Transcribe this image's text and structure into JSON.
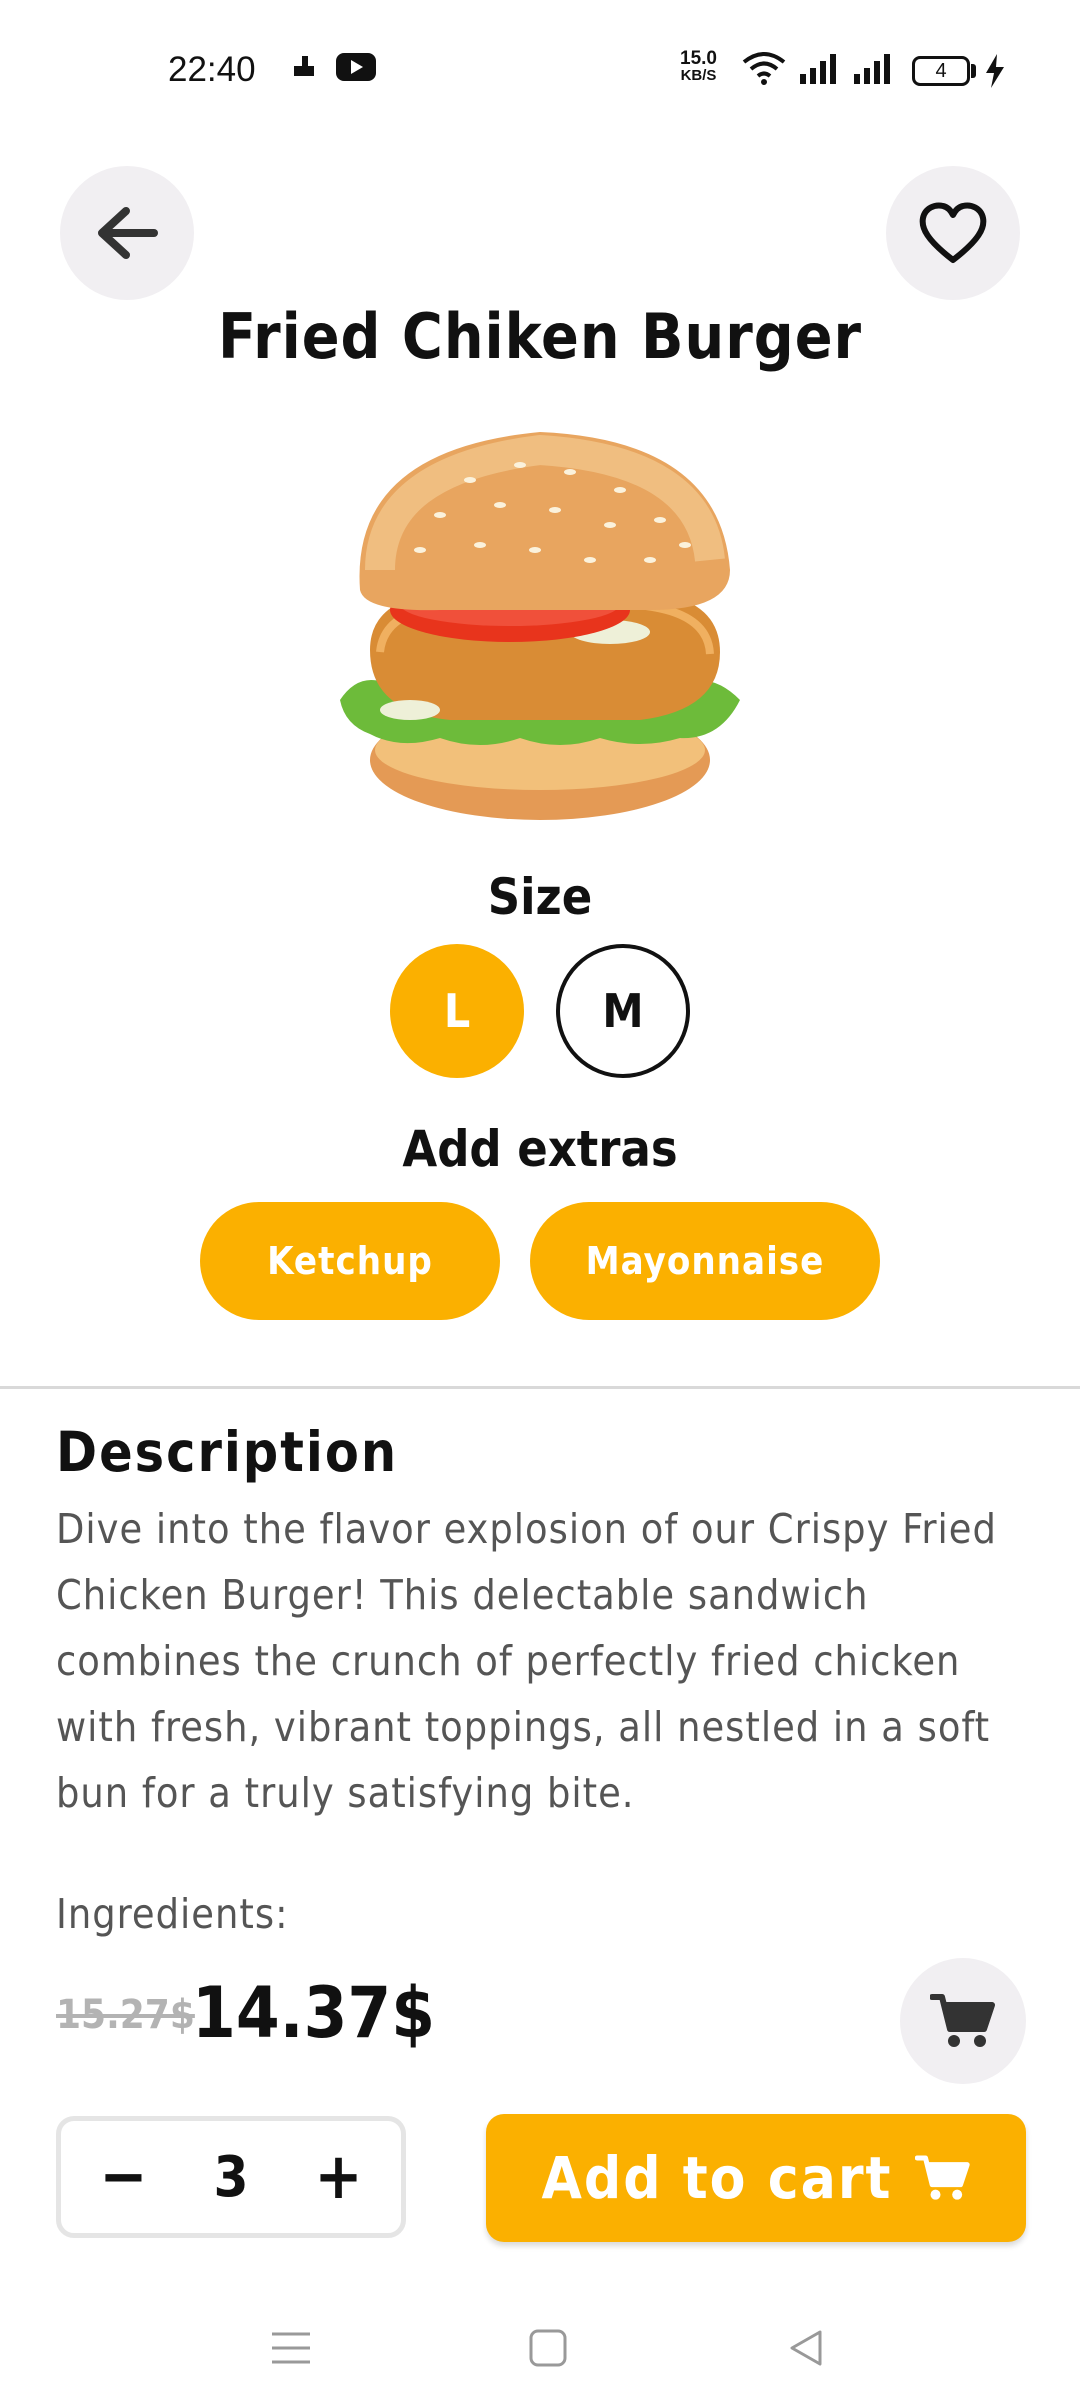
{
  "status_bar": {
    "time": "22:40",
    "net_speed_value": "15.0",
    "net_speed_unit": "KB/S",
    "battery_level": "4",
    "icons": [
      "notification-icon",
      "youtube-icon",
      "wifi-icon",
      "signal-icon",
      "signal-icon",
      "battery-icon",
      "charging-icon"
    ]
  },
  "header": {
    "back_icon": "arrow-left-icon",
    "favorite_icon": "heart-icon",
    "title": "Fried Chiken Burger"
  },
  "product": {
    "image": "fried-chicken-burger"
  },
  "size": {
    "label": "Size",
    "options": [
      "L",
      "M"
    ],
    "selected": "L"
  },
  "extras": {
    "label": "Add extras",
    "items": [
      "Ketchup",
      "Mayonnaise"
    ]
  },
  "description": {
    "title": "Description",
    "text": "Dive into the flavor explosion of our Crispy Fried Chicken Burger! This delectable sandwich combines the crunch of perfectly fried chicken with fresh, vibrant toppings, all nestled in a soft bun for a truly satisfying bite.",
    "ingredients_label": "Ingredients:"
  },
  "price": {
    "old": "15.27$",
    "current": "14.37$",
    "cart_icon": "cart-icon"
  },
  "quantity": {
    "decrement": "−",
    "value": "3",
    "increment": "+"
  },
  "add_to_cart": {
    "label": "Add to cart",
    "icon": "cart-icon"
  },
  "nav_bar": {
    "icons": [
      "menu-icon",
      "home-icon",
      "back-icon"
    ]
  },
  "colors": {
    "accent": "#fbb000",
    "button_bg": "#f1eff2",
    "text": "#111111",
    "muted_text": "#555555"
  }
}
